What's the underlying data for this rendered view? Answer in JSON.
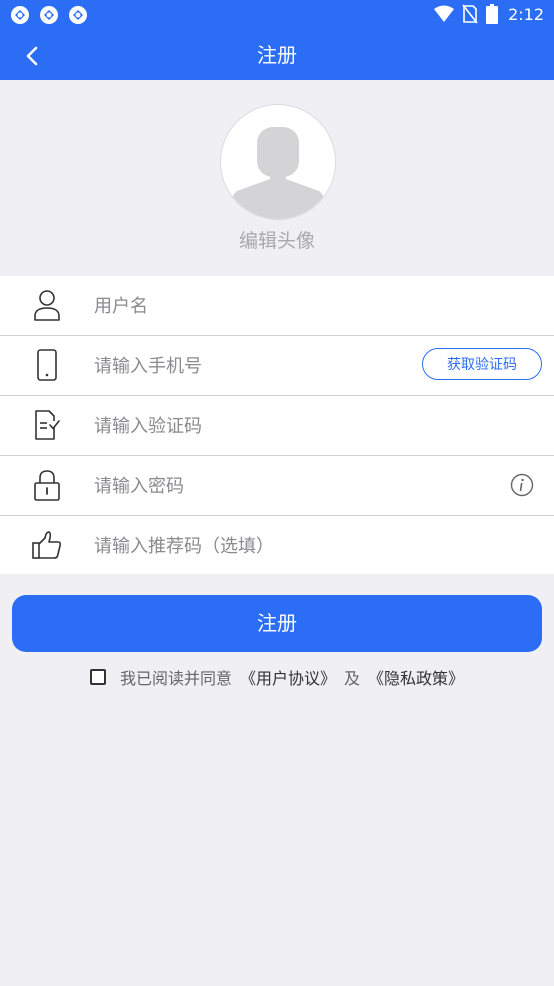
{
  "status_bar": {
    "time": "2:12",
    "icons": [
      "app-notification-icon",
      "app-notification-icon",
      "app-notification-icon",
      "wifi-icon",
      "no-sim-icon",
      "battery-icon"
    ]
  },
  "app_bar": {
    "title": "注册",
    "back_icon": "chevron-left-icon"
  },
  "avatar": {
    "label": "编辑头像",
    "icon": "default-avatar-icon"
  },
  "form": {
    "username": {
      "placeholder": "用户名",
      "value": "",
      "icon": "user-icon"
    },
    "phone": {
      "placeholder": "请输入手机号",
      "value": "",
      "icon": "phone-icon"
    },
    "get_code_label": "获取验证码",
    "code": {
      "placeholder": "请输入验证码",
      "value": "",
      "icon": "verification-doc-icon"
    },
    "password": {
      "placeholder": "请输入密码",
      "value": "",
      "icon": "lock-icon",
      "info_icon": "info-icon"
    },
    "referral": {
      "placeholder": "请输入推荐码（选填）",
      "value": "",
      "icon": "thumbs-up-icon"
    }
  },
  "submit_label": "注册",
  "agreement": {
    "checked": false,
    "prefix": "我已阅读并同意",
    "user_agreement": "《用户协议》",
    "conjunction": "及",
    "privacy_policy": "《隐私政策》"
  },
  "colors": {
    "primary": "#2b6ef5",
    "background": "#efeff4"
  }
}
